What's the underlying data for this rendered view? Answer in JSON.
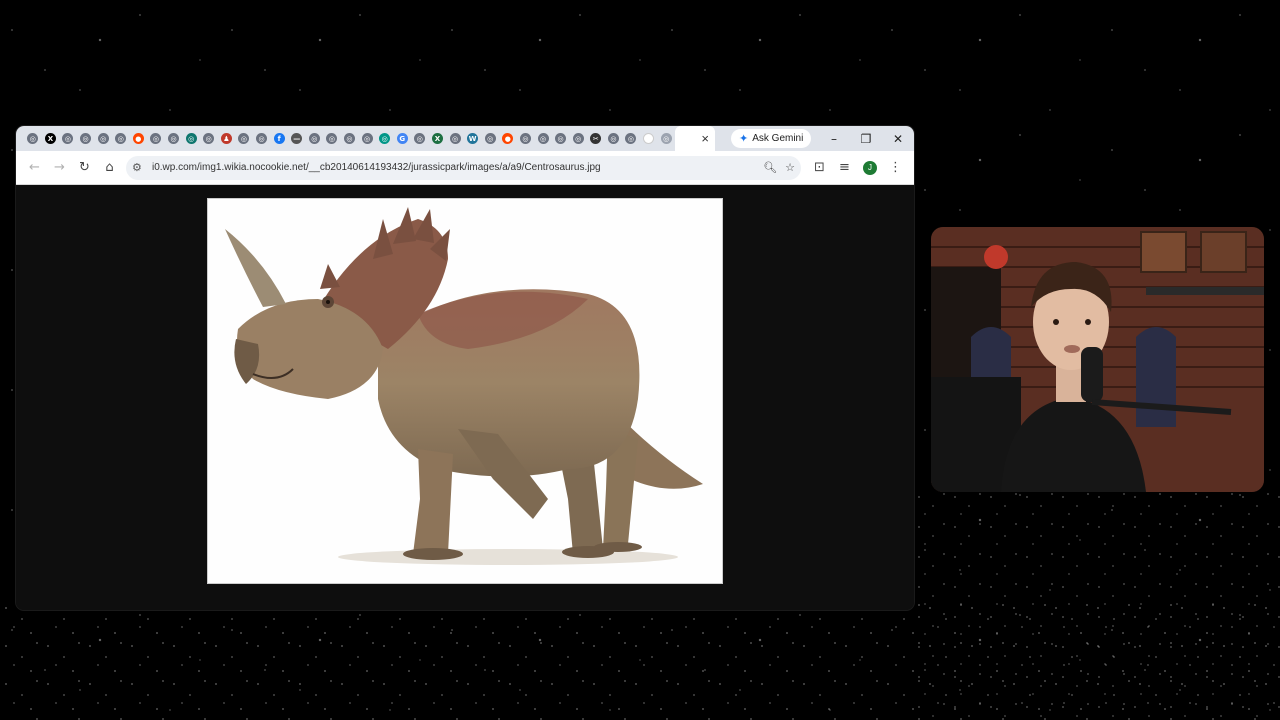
{
  "browser": {
    "tabs": {
      "favicons": [
        "chrome",
        "x",
        "chrome",
        "chrome",
        "chrome",
        "chrome",
        "reddit",
        "chrome",
        "chrome",
        "edge",
        "chrome",
        "jurassic",
        "chrome",
        "chrome",
        "facebook",
        "minus",
        "chrome",
        "chrome",
        "chrome",
        "chrome",
        "wiki",
        "google",
        "chrome",
        "excel",
        "chrome",
        "wordpress",
        "chrome",
        "reddit",
        "chrome",
        "chrome",
        "chrome",
        "chrome",
        "scissors",
        "chrome",
        "chrome",
        "blank",
        "gray"
      ],
      "active_close": "×",
      "new_tab": "+"
    },
    "gemini_label": "Ask Gemini",
    "window_controls": {
      "minimize": "–",
      "restore": "❐",
      "close": "✕"
    },
    "toolbar": {
      "back": "←",
      "forward": "→",
      "reload": "↻",
      "home": "⌂",
      "url": "i0.wp.com/img1.wikia.nocookie.net/__cb20140614193432/jurassicpark/images/a/a9/Centrosaurus.jpg",
      "profile_initial": "J"
    }
  },
  "colors": {
    "tabstrip": "#dfe3ea",
    "omnibox": "#eef1f5",
    "dino_body": "#9c8466",
    "dino_frill": "#8a5a48",
    "background": "#000000"
  }
}
